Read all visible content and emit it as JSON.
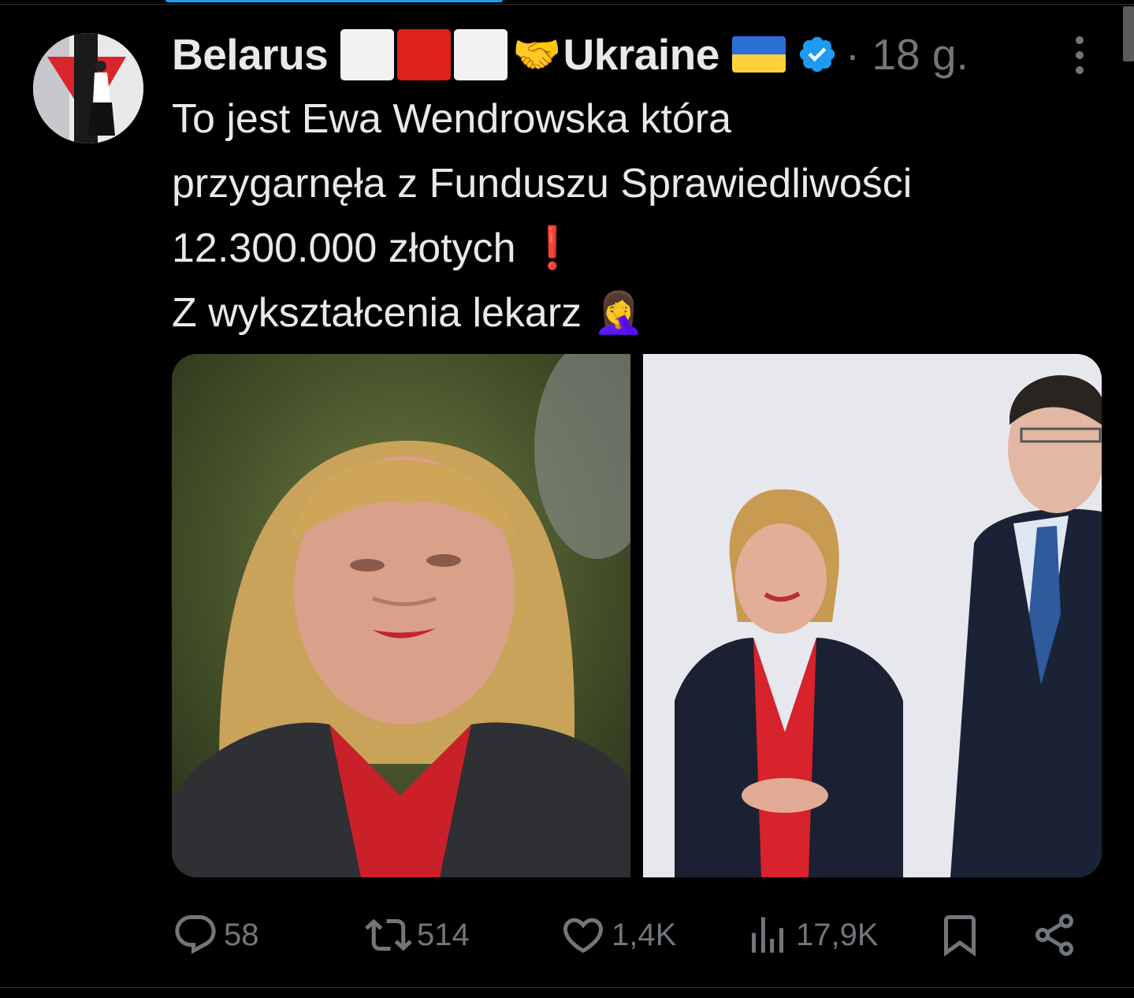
{
  "tweet": {
    "author_name": "Belarus",
    "author_name_suffix": "Ukraine",
    "time": "· 18 g.",
    "text_lines": [
      "To jest Ewa Wendrowska która",
      "przygarnęła z Funduszu Sprawiedliwości",
      "12.300.000 złotych",
      "Z wykształcenia lekarz"
    ],
    "exclamation": "❗",
    "facepalm": "🤦‍♀️",
    "handshake": "🤝"
  },
  "actions": {
    "replies": "58",
    "reposts": "514",
    "likes": "1,4K",
    "views": "17,9K"
  },
  "icons": {
    "reply": "reply-icon",
    "repost": "repost-icon",
    "like": "heart-icon",
    "views": "views-icon",
    "bookmark": "bookmark-icon",
    "share": "share-icon",
    "verified": "verified-badge-icon",
    "more": "more-options-icon"
  },
  "colors": {
    "background": "#000000",
    "text": "#e7e9ea",
    "muted": "#71767b",
    "verified": "#1d9bf0"
  }
}
